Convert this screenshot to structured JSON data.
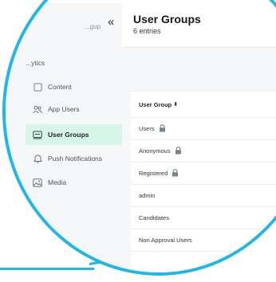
{
  "brand": {
    "tail_text": "...gup"
  },
  "sidebar": {
    "collapse_icon": "double-chevron-left-icon",
    "items": [
      {
        "label": "...ytics",
        "icon": "analytics-icon",
        "active": false
      },
      {
        "label": "Content",
        "icon": "content-icon",
        "active": false
      },
      {
        "label": "App Users",
        "icon": "users-icon",
        "active": false
      },
      {
        "label": "User Groups",
        "icon": "user-groups-icon",
        "active": true
      },
      {
        "label": "Push Notifications",
        "icon": "bell-icon",
        "active": false
      },
      {
        "label": "Media",
        "icon": "image-icon",
        "active": false
      }
    ]
  },
  "header": {
    "title": "User Groups",
    "subtitle": "6 entries"
  },
  "table": {
    "column_header": "User Group",
    "sort_glyph": "⬍",
    "rows": [
      {
        "label": "Users",
        "locked": true
      },
      {
        "label": "Anonymous",
        "locked": true
      },
      {
        "label": "Registered",
        "locked": true
      },
      {
        "label": "admin",
        "locked": false
      },
      {
        "label": "Candidates",
        "locked": false
      },
      {
        "label": "Non Approval Users",
        "locked": false
      }
    ]
  },
  "colors": {
    "lens_border": "#1eb7e7",
    "active_bg": "#d8f5ea",
    "sidebar_bg": "#f6f7f9"
  }
}
